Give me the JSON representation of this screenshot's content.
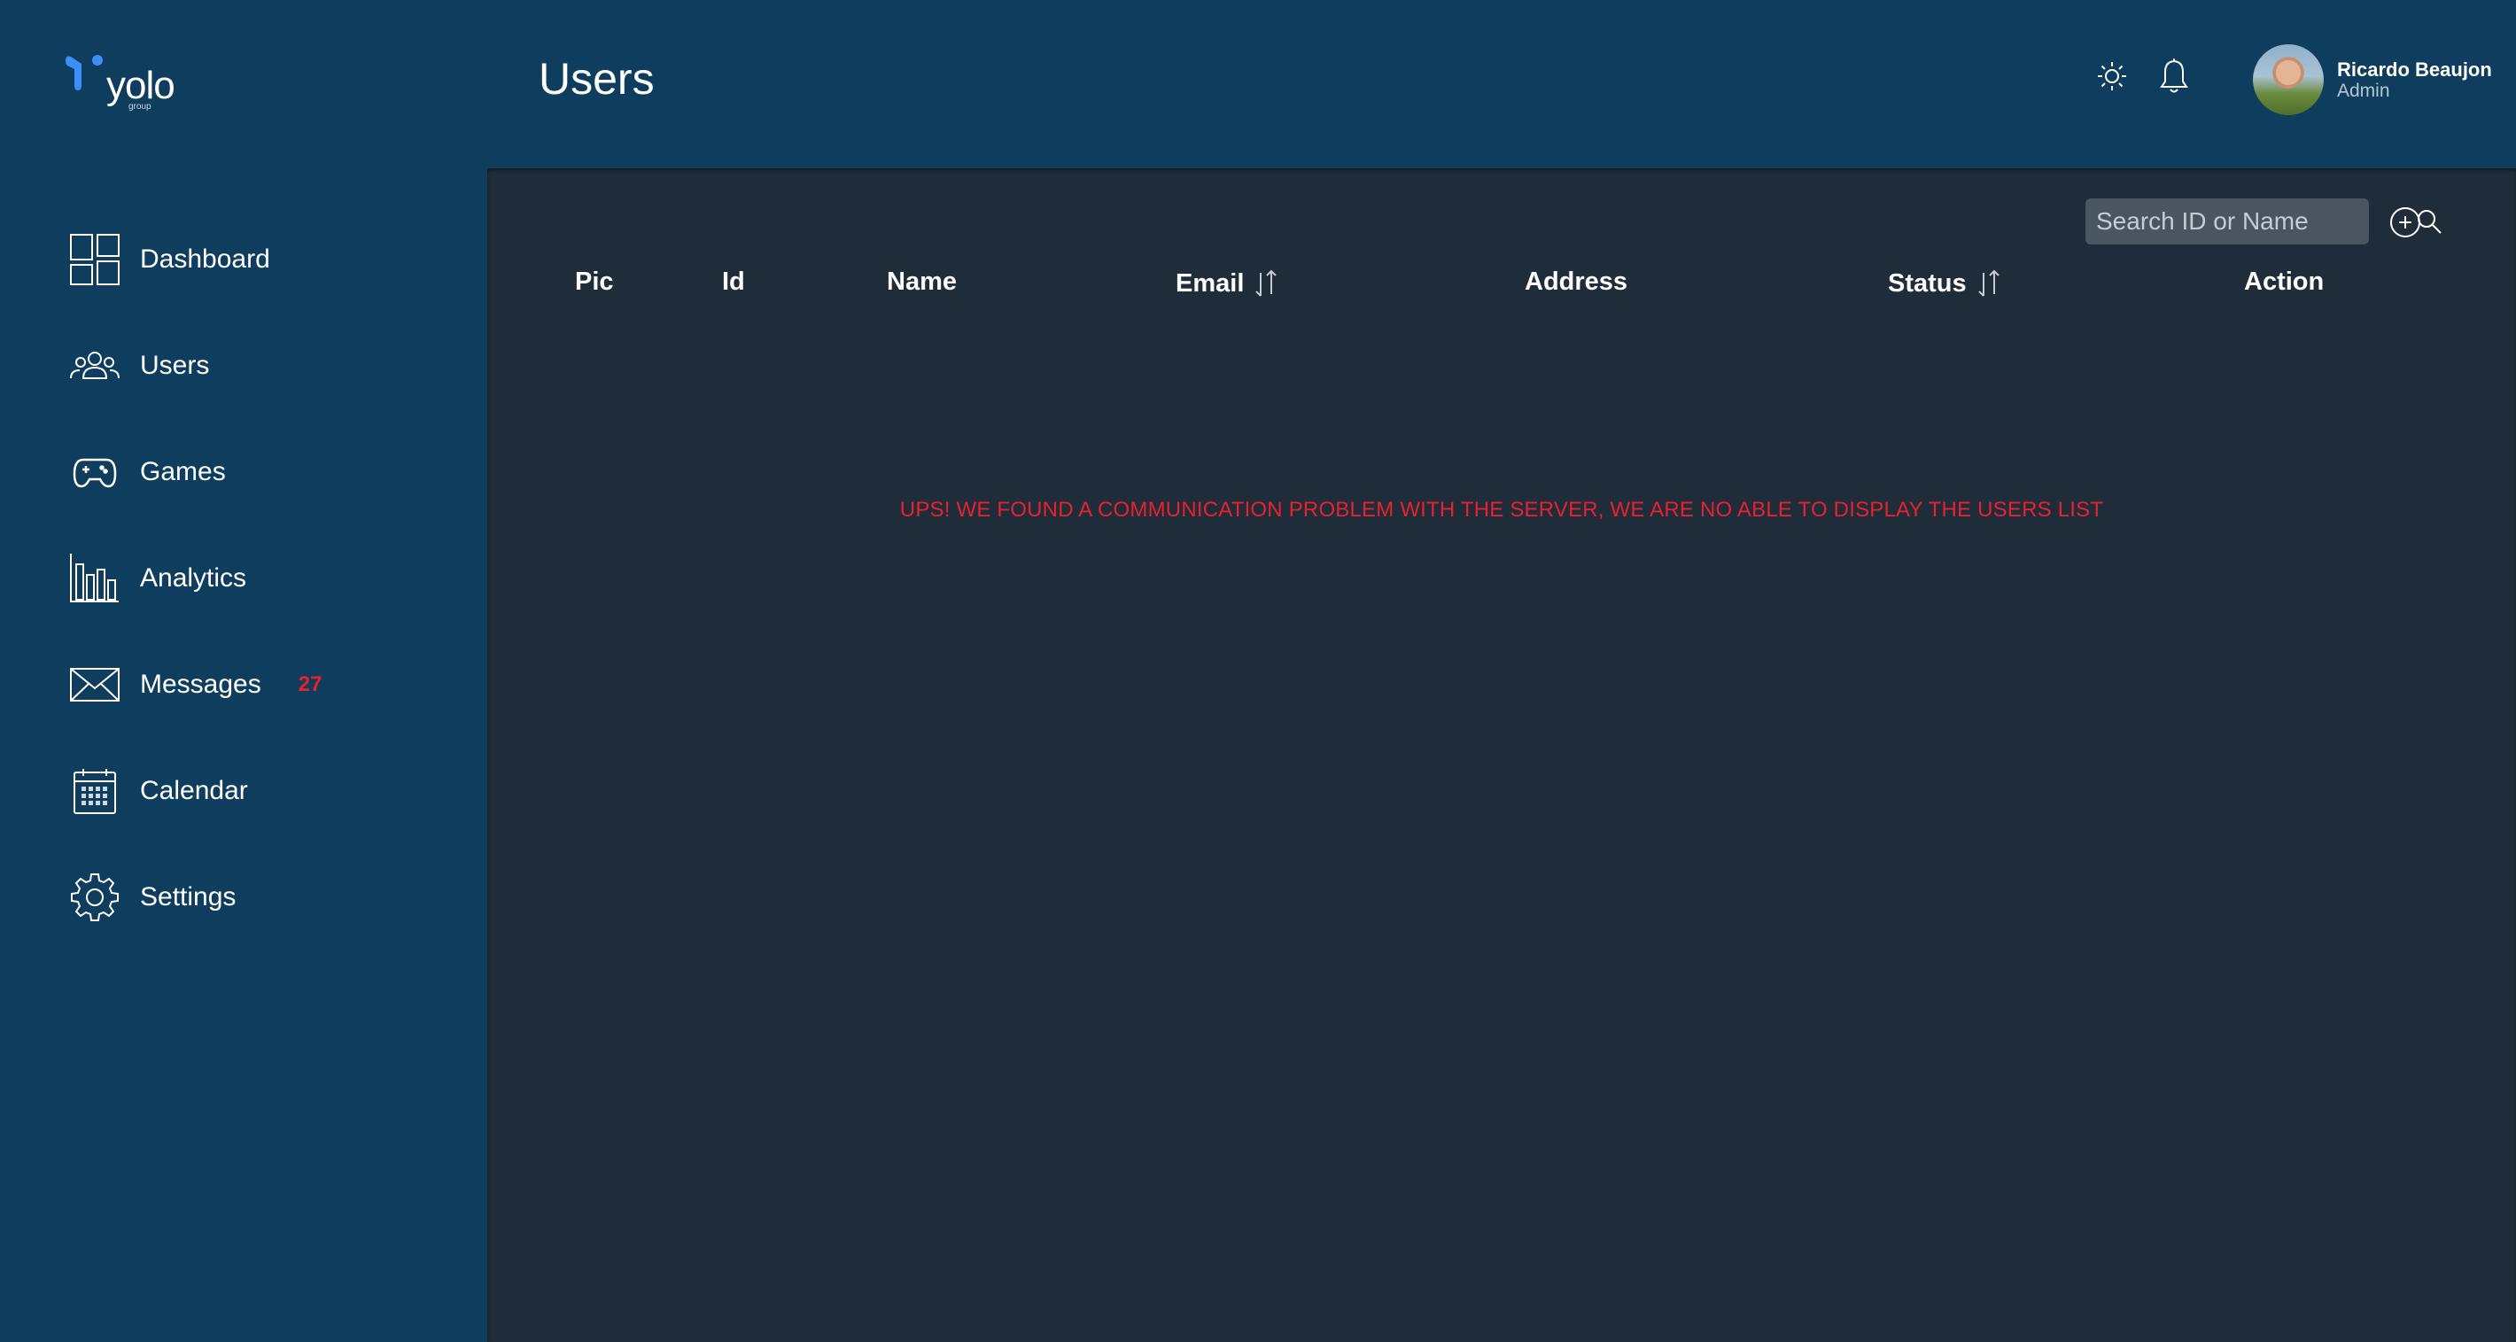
{
  "brand": {
    "name": "yolo",
    "sub": "group",
    "accent": "#3d8ff5"
  },
  "header": {
    "title": "Users",
    "icons": [
      "sun-icon",
      "bell-icon"
    ],
    "user": {
      "name": "Ricardo Beaujon",
      "role": "Admin"
    }
  },
  "sidebar": {
    "items": [
      {
        "label": "Dashboard",
        "icon": "dashboard-icon"
      },
      {
        "label": "Users",
        "icon": "users-icon"
      },
      {
        "label": "Games",
        "icon": "gamepad-icon"
      },
      {
        "label": "Analytics",
        "icon": "analytics-icon"
      },
      {
        "label": "Messages",
        "icon": "envelope-icon",
        "badge": "27"
      },
      {
        "label": "Calendar",
        "icon": "calendar-icon"
      },
      {
        "label": "Settings",
        "icon": "gear-icon"
      }
    ]
  },
  "search": {
    "placeholder": "Search ID or Name",
    "value": ""
  },
  "table": {
    "columns": [
      {
        "label": "Pic",
        "sortable": false
      },
      {
        "label": "Id",
        "sortable": false
      },
      {
        "label": "Name",
        "sortable": false
      },
      {
        "label": "Email",
        "sortable": true
      },
      {
        "label": "Address",
        "sortable": false
      },
      {
        "label": "Status",
        "sortable": true
      },
      {
        "label": "Action",
        "sortable": false
      }
    ],
    "rows": []
  },
  "error": {
    "message": "UPS! WE FOUND A COMMUNICATION PROBLEM WITH THE SERVER, WE ARE NO ABLE TO DISPLAY THE USERS LIST",
    "color": "#e8212e"
  },
  "colors": {
    "sidebar": "#0f3d5e",
    "main": "#1f2c3a",
    "badge": "#e8212e"
  }
}
